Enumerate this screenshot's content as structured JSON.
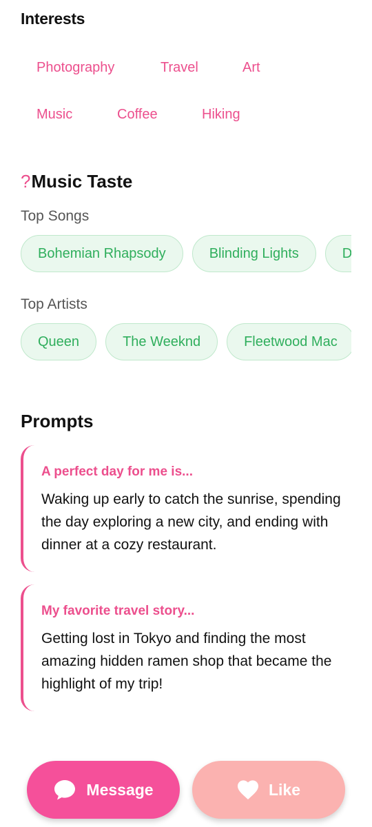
{
  "interests": {
    "title": "Interests",
    "tags": [
      "Photography",
      "Travel",
      "Art",
      "Music",
      "Coffee",
      "Hiking"
    ]
  },
  "music_taste": {
    "icon_char": "?",
    "title": "Music Taste",
    "top_songs_label": "Top Songs",
    "top_songs": [
      "Bohemian Rhapsody",
      "Blinding Lights",
      "Dreams"
    ],
    "top_artists_label": "Top Artists",
    "top_artists": [
      "Queen",
      "The Weeknd",
      "Fleetwood Mac"
    ]
  },
  "prompts": {
    "title": "Prompts",
    "items": [
      {
        "question": "A perfect day for me is...",
        "answer": "Waking up early to catch the sunrise, spending the day exploring a new city, and ending with dinner at a cozy restaurant."
      },
      {
        "question": "My favorite travel story...",
        "answer": "Getting lost in Tokyo and finding the most amazing hidden ramen shop that became the highlight of my trip!"
      }
    ]
  },
  "actions": {
    "message_label": "Message",
    "like_label": "Like",
    "message_icon": "chat-bubble-icon",
    "like_icon": "heart-icon"
  },
  "colors": {
    "accent_pink": "#ec4f8d",
    "message_button": "#f5509a",
    "like_button": "#fbb2b0",
    "chip_background": "#eaf8ee",
    "chip_text": "#2fae5c"
  }
}
